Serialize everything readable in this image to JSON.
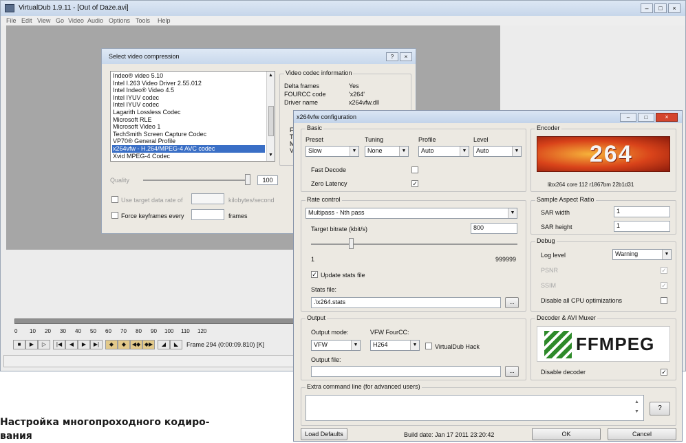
{
  "vdub": {
    "title": "VirtualDub 1.9.11 - [Out of Daze.avi]",
    "menu": [
      "File",
      "Edit",
      "View",
      "Go",
      "Video",
      "Audio",
      "Options",
      "Tools",
      "Help"
    ],
    "timeline_ticks": [
      "0",
      "10",
      "20",
      "30",
      "40",
      "50",
      "60",
      "70",
      "80",
      "90",
      "100",
      "110",
      "120"
    ],
    "frame_label": "Frame 294 (0:00:09.810) [K]"
  },
  "compress": {
    "title": "Select video compression",
    "codecs": [
      "Indeo® video 5.10",
      "Intel I.263 Video Driver 2.55.012",
      "Intel Indeo® Video 4.5",
      "Intel IYUV codec",
      "Intel IYUV codec",
      "Lagarith Lossless Codec",
      "Microsoft RLE",
      "Microsoft Video 1",
      "TechSmith Screen Capture Codec",
      "VP70® General Profile",
      "x264vfw - H.264/MPEG-4 AVC codec",
      "Xvid MPEG-4 Codec"
    ],
    "selected_index": 10,
    "info_group": "Video codec information",
    "info_rows": [
      {
        "label": "Delta frames",
        "value": "Yes"
      },
      {
        "label": "FOURCC code",
        "value": "'x264'"
      },
      {
        "label": "Driver name",
        "value": "x264vfw.dll"
      }
    ],
    "info_frag": [
      "Fea",
      "Tel",
      "Mar",
      "Valu"
    ],
    "quality_label": "Quality",
    "quality_value": "100",
    "datarate_label": "Use target data rate of",
    "datarate_unit": "kilobytes/second",
    "keyframes_label": "Force keyframes every",
    "keyframes_unit": "frames"
  },
  "x264": {
    "title": "x264vfw configuration",
    "basic": {
      "group": "Basic",
      "preset_label": "Preset",
      "preset": "Slow",
      "tuning_label": "Tuning",
      "tuning": "None",
      "profile_label": "Profile",
      "profile": "Auto",
      "level_label": "Level",
      "level": "Auto",
      "fast_decode": "Fast Decode",
      "zero_latency": "Zero Latency"
    },
    "encoder": {
      "group": "Encoder",
      "logo": "264",
      "version": "libx264 core 112 r1867bm 22b1d31"
    },
    "rate": {
      "group": "Rate control",
      "mode": "Multipass - Nth pass",
      "bitrate_label": "Target bitrate (kbit/s)",
      "bitrate": "800",
      "slider_min": "1",
      "slider_max": "999999",
      "slider_pos": 0.15,
      "update_stats": "Update stats file",
      "stats_label": "Stats file:",
      "stats_file": ".\\x264.stats",
      "browse": "..."
    },
    "sar": {
      "group": "Sample Aspect Ratio",
      "width_label": "SAR width",
      "width": "1",
      "height_label": "SAR height",
      "height": "1"
    },
    "debug": {
      "group": "Debug",
      "log_label": "Log level",
      "log_level": "Warning",
      "psnr": "PSNR",
      "ssim": "SSIM",
      "disable_cpu": "Disable all CPU optimizations"
    },
    "output": {
      "group": "Output",
      "mode_label": "Output mode:",
      "mode": "VFW",
      "fourcc_label": "VFW FourCC:",
      "fourcc": "H264",
      "hack": "VirtualDub Hack",
      "file_label": "Output file:",
      "browse": "..."
    },
    "decoder": {
      "group": "Decoder & AVI Muxer",
      "logo": "FFMPEG",
      "disable": "Disable decoder"
    },
    "extra": {
      "group": "Extra command line (for advanced users)",
      "help": "?"
    },
    "load_defaults": "Load Defaults",
    "build_date": "Build date: Jan 17 2011 23:20:42",
    "ok": "OK",
    "cancel": "Cancel"
  },
  "caption": "Настройка многопроходного кодиро-\nвания",
  "colors": {
    "workspace": "#a6a6a6",
    "dialog_bg": "#ece9e2",
    "selection": "#3a6fc6",
    "title_bar": "#c9d8ec",
    "close_red": "#d4452e"
  }
}
